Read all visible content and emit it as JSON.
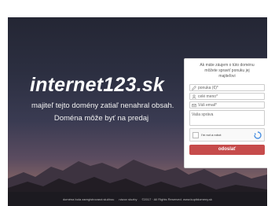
{
  "hero": {
    "headline": "internet123.sk",
    "line1": "majiteľ tejto domény zatiaľ nenahral obsah.",
    "line2": "Doména môže byť na predaj"
  },
  "form": {
    "intro_line1": "Ak máte záujem o túto doménu",
    "intro_line2": "môžete spraviť ponuku jej",
    "intro_line3": "majiteľovi",
    "offer_placeholder": "ponuka (€)*",
    "name_placeholder": "celé meno*",
    "email_placeholder": "Váš email*",
    "message_placeholder": "Vaša správa",
    "captcha_label": "I'm not a robot",
    "submit_label": "odoslať"
  },
  "footer": {
    "link1": "doména bola zaregistrovaná službou",
    "link2": "názov sluzby",
    "copyright": "©2017 · All Rights Reserved. www.kupitdomeny.sk"
  },
  "colors": {
    "accent": "#c64b4b",
    "footer_bg": "#1c1a20"
  }
}
